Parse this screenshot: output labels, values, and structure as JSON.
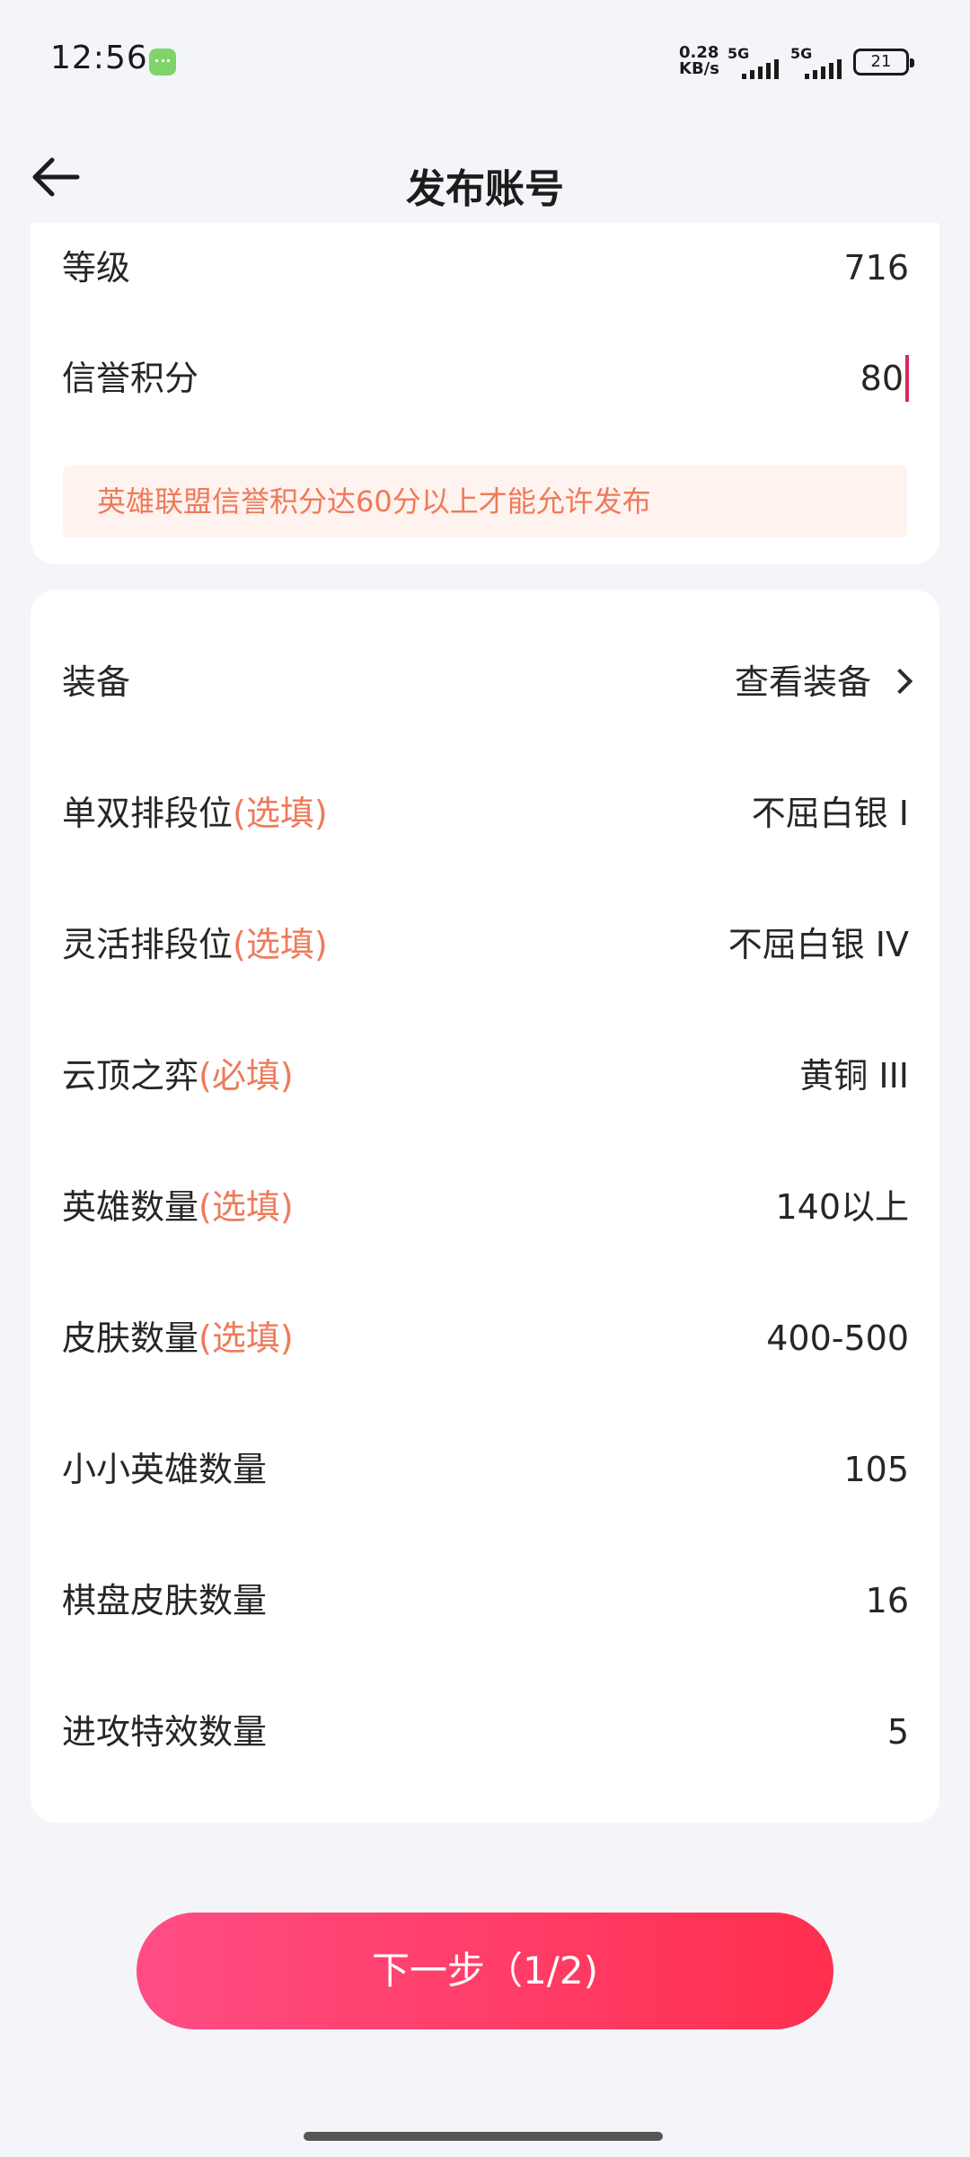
{
  "status_bar": {
    "time": "12:56",
    "net_speed_value": "0.28",
    "net_speed_unit": "KB/s",
    "sim1_label": "5G",
    "sim2_label": "5G",
    "battery": "21"
  },
  "header": {
    "title": "发布账号"
  },
  "card1": {
    "rows": [
      {
        "label": "等级",
        "value": "716"
      },
      {
        "label": "信誉积分",
        "value": "80"
      }
    ],
    "notice": "英雄联盟信誉积分达60分以上才能允许发布"
  },
  "card2": {
    "equipment": {
      "label": "装备",
      "value": "查看装备"
    },
    "rows": [
      {
        "label": "单双排段位",
        "hint": "(选填)",
        "value": "不屈白银 I"
      },
      {
        "label": "灵活排段位",
        "hint": "(选填)",
        "value": "不屈白银 IV"
      },
      {
        "label": "云顶之弈",
        "hint": "(必填)",
        "value": "黄铜 III"
      },
      {
        "label": "英雄数量",
        "hint": "(选填)",
        "value": "140以上"
      },
      {
        "label": "皮肤数量",
        "hint": "(选填)",
        "value": "400-500"
      },
      {
        "label": "小小英雄数量",
        "hint": "",
        "value": "105"
      },
      {
        "label": "棋盘皮肤数量",
        "hint": "",
        "value": "16"
      },
      {
        "label": "进攻特效数量",
        "hint": "",
        "value": "5"
      }
    ]
  },
  "footer": {
    "next_label": "下一步（1/2)"
  },
  "colors": {
    "accent_start": "#ff4d84",
    "accent_end": "#ff2f4e",
    "hint": "#ef7a5a",
    "background": "#f3f5f9"
  }
}
